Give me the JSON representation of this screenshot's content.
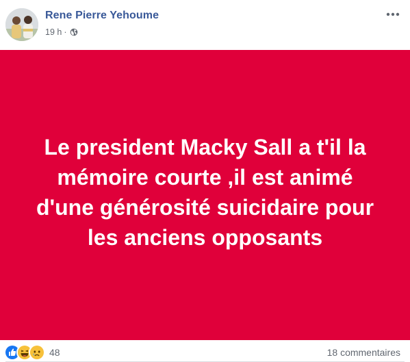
{
  "post": {
    "author": "Rene Pierre Yehoume",
    "time": "19 h",
    "separator": "·",
    "privacy_icon": "globe-icon",
    "menu_icon": "more-options-icon",
    "banner": {
      "background": "#e0003a",
      "text_color": "#ffffff",
      "text": "Le president Macky Sall a t'il la mémoire courte ,il est animé d'une générosité suicidaire pour les anciens opposants"
    }
  },
  "footer": {
    "reaction_icons": [
      "like-icon",
      "haha-icon",
      "sad-icon"
    ],
    "reaction_count": "48",
    "comments": "18 commentaires"
  },
  "colors": {
    "author_link": "#385898",
    "meta_text": "#616770"
  }
}
